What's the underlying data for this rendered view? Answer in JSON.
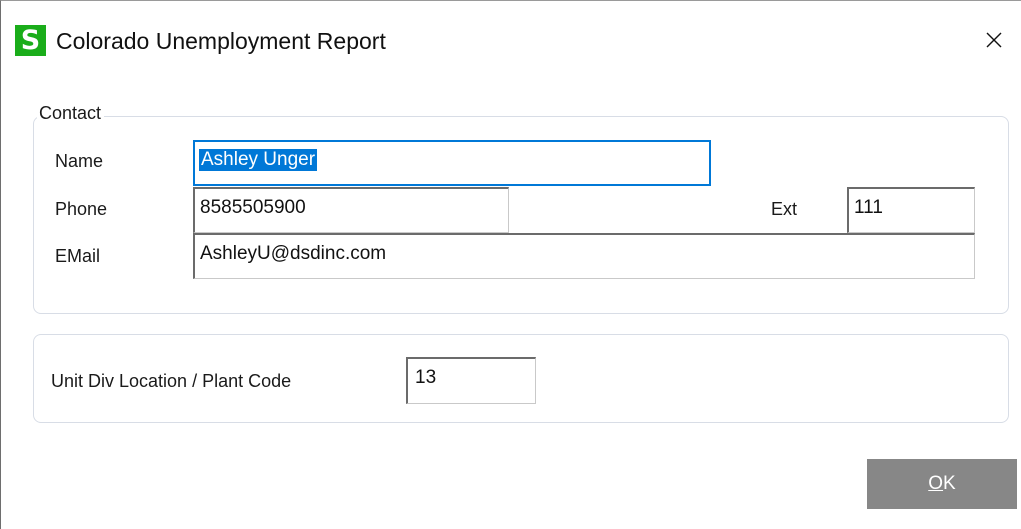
{
  "window": {
    "title": "Colorado Unemployment Report",
    "app_icon_letter": "S",
    "accent_color": "#1aad1a",
    "close_icon": "close-icon"
  },
  "contact": {
    "legend": "Contact",
    "name_label": "Name",
    "name_value": "Ashley Unger",
    "phone_label": "Phone",
    "phone_value": "8585505900",
    "ext_label": "Ext",
    "ext_value": "111",
    "email_label": "EMail",
    "email_value": "AshleyU@dsdinc.com"
  },
  "unit": {
    "label": "Unit Div Location / Plant Code",
    "value": "13"
  },
  "buttons": {
    "ok_mnemonic": "O",
    "ok_rest": "K"
  },
  "colors": {
    "focus_border": "#0078d7",
    "selection": "#0078d7",
    "ok_button_bg": "#878787"
  }
}
